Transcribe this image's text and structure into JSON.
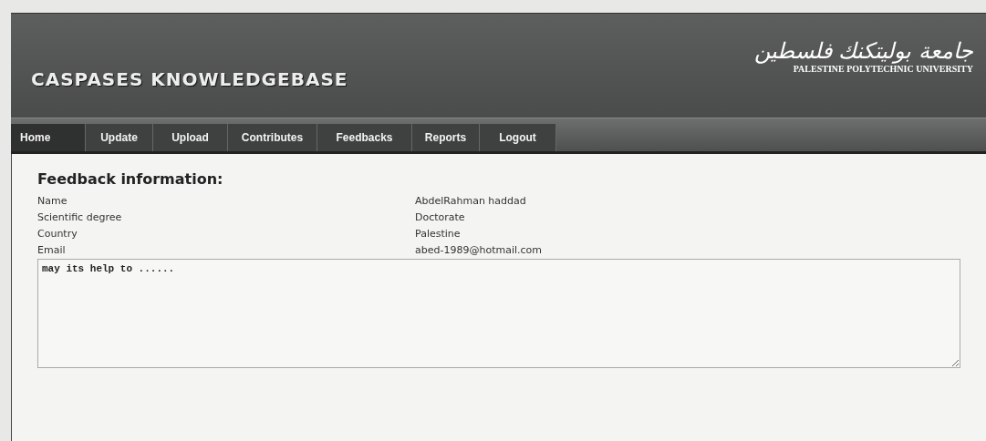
{
  "header": {
    "title": "CASPASES KNOWLEDGEBASE",
    "logo_arabic": "جامعة بوليتكنك فلسطين",
    "logo_english": "PALESTINE POLYTECHNIC UNIVERSITY"
  },
  "nav": [
    {
      "label": "Home",
      "selected": true
    },
    {
      "label": "Update",
      "selected": false
    },
    {
      "label": "Upload",
      "selected": false
    },
    {
      "label": "Contributes",
      "selected": false
    },
    {
      "label": "Feedbacks",
      "selected": false
    },
    {
      "label": "Reports",
      "selected": false
    },
    {
      "label": "Logout",
      "selected": false
    }
  ],
  "feedback": {
    "heading": "Feedback information:",
    "fields": [
      {
        "label": "Name",
        "value": "AbdelRahman haddad"
      },
      {
        "label": "Scientific degree",
        "value": "Doctorate"
      },
      {
        "label": "Country",
        "value": "Palestine"
      },
      {
        "label": "Email",
        "value": "abed-1989@hotmail.com"
      }
    ],
    "message": "may its help to ......"
  }
}
